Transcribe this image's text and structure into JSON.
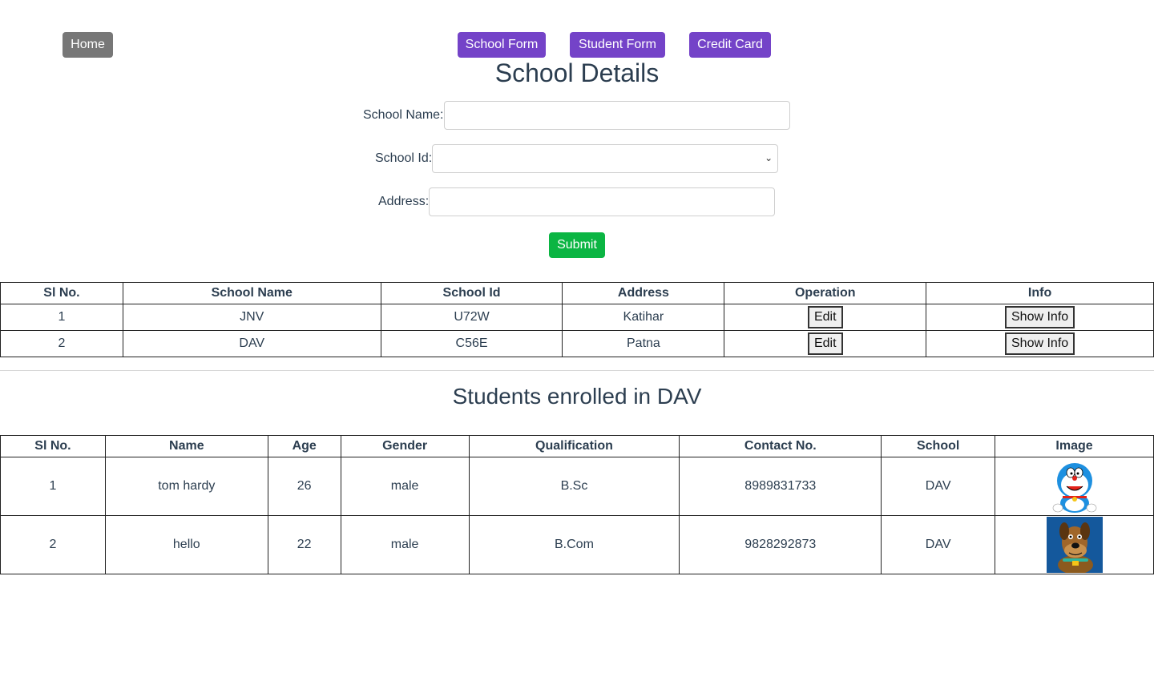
{
  "nav": {
    "home": "Home",
    "school_form": "School Form",
    "student_form": "Student Form",
    "credit_card": "Credit Card"
  },
  "school_details": {
    "title": "School Details",
    "name_label": "School Name:",
    "name_value": "",
    "id_label": "School Id:",
    "id_selected": "",
    "address_label": "Address:",
    "address_value": "",
    "submit": "Submit"
  },
  "schools_table": {
    "headers": [
      "Sl No.",
      "School Name",
      "School Id",
      "Address",
      "Operation",
      "Info"
    ],
    "rows": [
      {
        "sl": "1",
        "name": "JNV",
        "id": "U72W",
        "address": "Katihar",
        "edit": "Edit",
        "info": "Show Info"
      },
      {
        "sl": "2",
        "name": "DAV",
        "id": "C56E",
        "address": "Patna",
        "edit": "Edit",
        "info": "Show Info"
      }
    ]
  },
  "students": {
    "title": "Students enrolled in DAV",
    "headers": [
      "Sl No.",
      "Name",
      "Age",
      "Gender",
      "Qualification",
      "Contact No.",
      "School",
      "Image"
    ],
    "rows": [
      {
        "sl": "1",
        "name": "tom hardy",
        "age": "26",
        "gender": "male",
        "qualification": "B.Sc",
        "contact": "8989831733",
        "school": "DAV",
        "image": "doraemon-cartoon-image"
      },
      {
        "sl": "2",
        "name": "hello",
        "age": "22",
        "gender": "male",
        "qualification": "B.Com",
        "contact": "9828292873",
        "school": "DAV",
        "image": "scooby-doo-cartoon-image"
      }
    ]
  },
  "colors": {
    "home_button": "#777777",
    "nav_button": "#7443c8",
    "submit_button": "#0bb543",
    "text": "#2c3e50"
  }
}
